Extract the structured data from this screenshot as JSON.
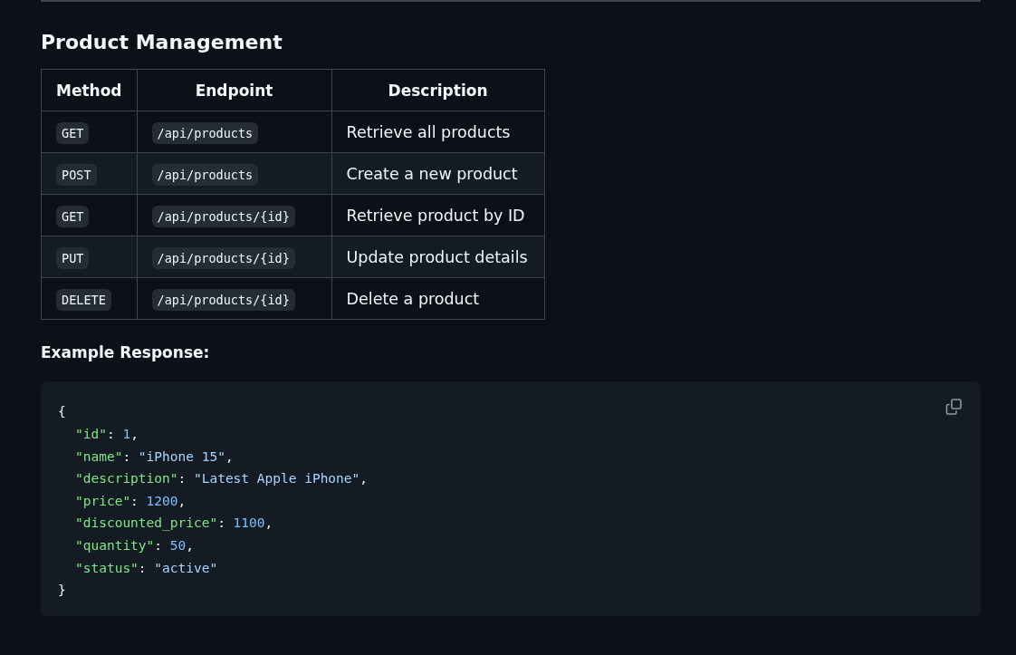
{
  "heading": "Product Management",
  "table": {
    "columns": [
      "Method",
      "Endpoint",
      "Description"
    ],
    "rows": [
      {
        "method": "GET",
        "endpoint": "/api/products",
        "description": "Retrieve all products"
      },
      {
        "method": "POST",
        "endpoint": "/api/products",
        "description": "Create a new product"
      },
      {
        "method": "GET",
        "endpoint": "/api/products/{id}",
        "description": "Retrieve product by ID"
      },
      {
        "method": "PUT",
        "endpoint": "/api/products/{id}",
        "description": "Update product details"
      },
      {
        "method": "DELETE",
        "endpoint": "/api/products/{id}",
        "description": "Delete a product"
      }
    ]
  },
  "example_label": "Example Response:",
  "code": {
    "lines": [
      {
        "tokens": [
          {
            "kind": "punct",
            "text": "{"
          }
        ],
        "children": [
          {
            "tokens": [
              {
                "kind": "key",
                "text": "\"id\""
              },
              {
                "kind": "punct",
                "text": ": "
              },
              {
                "kind": "number",
                "text": "1"
              },
              {
                "kind": "punct",
                "text": ","
              }
            ]
          },
          {
            "tokens": [
              {
                "kind": "key",
                "text": "\"name\""
              },
              {
                "kind": "punct",
                "text": ": "
              },
              {
                "kind": "string",
                "text": "\"iPhone 15\""
              },
              {
                "kind": "punct",
                "text": ","
              }
            ]
          },
          {
            "tokens": [
              {
                "kind": "key",
                "text": "\"description\""
              },
              {
                "kind": "punct",
                "text": ": "
              },
              {
                "kind": "string",
                "text": "\"Latest Apple iPhone\""
              },
              {
                "kind": "punct",
                "text": ","
              }
            ]
          },
          {
            "tokens": [
              {
                "kind": "key",
                "text": "\"price\""
              },
              {
                "kind": "punct",
                "text": ": "
              },
              {
                "kind": "number",
                "text": "1200"
              },
              {
                "kind": "punct",
                "text": ","
              }
            ]
          },
          {
            "tokens": [
              {
                "kind": "key",
                "text": "\"discounted_price\""
              },
              {
                "kind": "punct",
                "text": ": "
              },
              {
                "kind": "number",
                "text": "1100"
              },
              {
                "kind": "punct",
                "text": ","
              }
            ]
          },
          {
            "tokens": [
              {
                "kind": "key",
                "text": "\"quantity\""
              },
              {
                "kind": "punct",
                "text": ": "
              },
              {
                "kind": "number",
                "text": "50"
              },
              {
                "kind": "punct",
                "text": ","
              }
            ]
          },
          {
            "tokens": [
              {
                "kind": "key",
                "text": "\"status\""
              },
              {
                "kind": "punct",
                "text": ": "
              },
              {
                "kind": "string",
                "text": "\"active\""
              }
            ]
          }
        ]
      },
      {
        "tokens": [
          {
            "kind": "punct",
            "text": "}"
          }
        ]
      }
    ]
  }
}
